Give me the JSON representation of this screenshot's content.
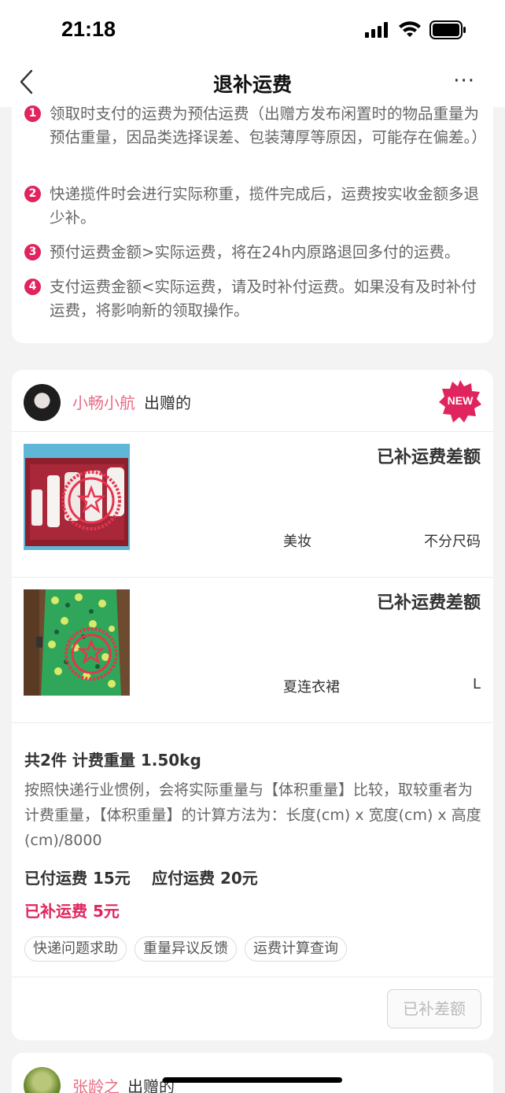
{
  "status_bar": {
    "time": "21:18"
  },
  "nav": {
    "title": "退补运费",
    "more": "···"
  },
  "rules": [
    {
      "num": "1",
      "text": "领取时支付的运费为预估运费（出赠方发布闲置时的物品重量为预估重量，因品类选择误差、包装薄厚等原因，可能存在偏差。）"
    },
    {
      "num": "2",
      "text": "快递揽件时会进行实际称重，揽件完成后，运费按实收金额多退少补。"
    },
    {
      "num": "3",
      "text": "预付运费金额>实际运费，将在24h内原路退回多付的运费。"
    },
    {
      "num": "4",
      "text": "支付运费金额<实际运费，请及时补付运费。如果没有及时补付运费，将影响新的领取操作。"
    }
  ],
  "order": {
    "giver_name": "小畅小航",
    "giver_suffix": "出赠的",
    "badge": "NEW",
    "items": [
      {
        "status": "已补运费差额",
        "category": "美妆",
        "size": "不分尺码"
      },
      {
        "status": "已补运费差额",
        "category": "夏连衣裙",
        "size": "L"
      }
    ],
    "summary": {
      "title": "共2件 计费重量 1.50kg",
      "desc": "按照快递行业惯例，会将实际重量与【体积重量】比较，取较重者为计费重量，【体积重量】的计算方法为：长度(cm) x 宽度(cm) x 高度(cm)/8000",
      "paid": "已付运费 15元",
      "due": "应付运费 20元",
      "supplemented": "已补运费 5元"
    },
    "tags": [
      "快递问题求助",
      "重量异议反馈",
      "运费计算查询"
    ],
    "button": "已补差额"
  },
  "next_order": {
    "giver_name": "张龄之",
    "giver_suffix": "出赠的"
  },
  "colors": {
    "accent": "#e0245e",
    "name_pink": "#e96b84"
  }
}
